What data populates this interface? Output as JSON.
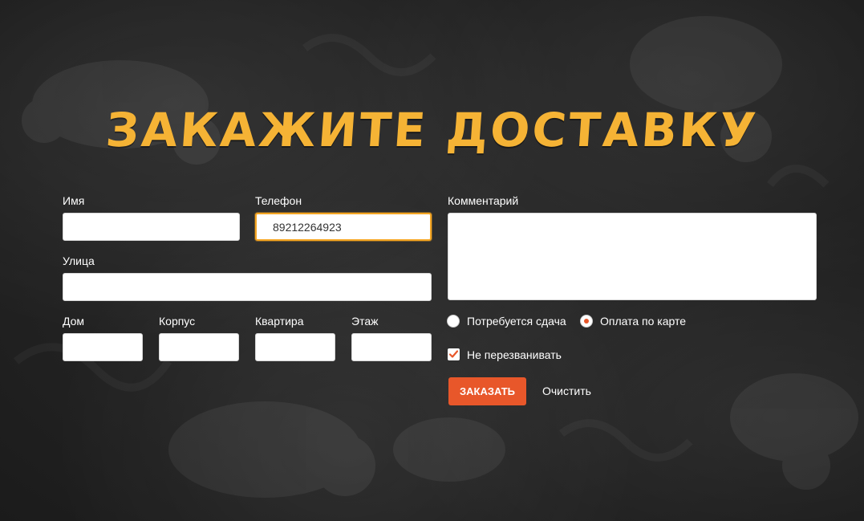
{
  "page": {
    "title": "ЗАКАЖИТЕ ДОСТАВКУ"
  },
  "form": {
    "name": {
      "label": "Имя",
      "value": ""
    },
    "phone": {
      "label": "Телефон",
      "value": "89212264923"
    },
    "comment": {
      "label": "Комментарий",
      "value": ""
    },
    "street": {
      "label": "Улица",
      "value": ""
    },
    "house": {
      "label": "Дом",
      "value": ""
    },
    "building": {
      "label": "Корпус",
      "value": ""
    },
    "apartment": {
      "label": "Квартира",
      "value": ""
    },
    "floor": {
      "label": "Этаж",
      "value": ""
    },
    "payment_options": [
      {
        "label": "Потребуется сдача",
        "selected": false
      },
      {
        "label": "Оплата по карте",
        "selected": true
      }
    ],
    "no_callback": {
      "label": "Не перезванивать",
      "checked": true
    },
    "submit_label": "ЗАКАЗАТЬ",
    "clear_label": "Очистить"
  },
  "colors": {
    "accent": "#e8572a",
    "title": "#f5b335",
    "focus_border": "#f5a623",
    "background": "#232323"
  }
}
